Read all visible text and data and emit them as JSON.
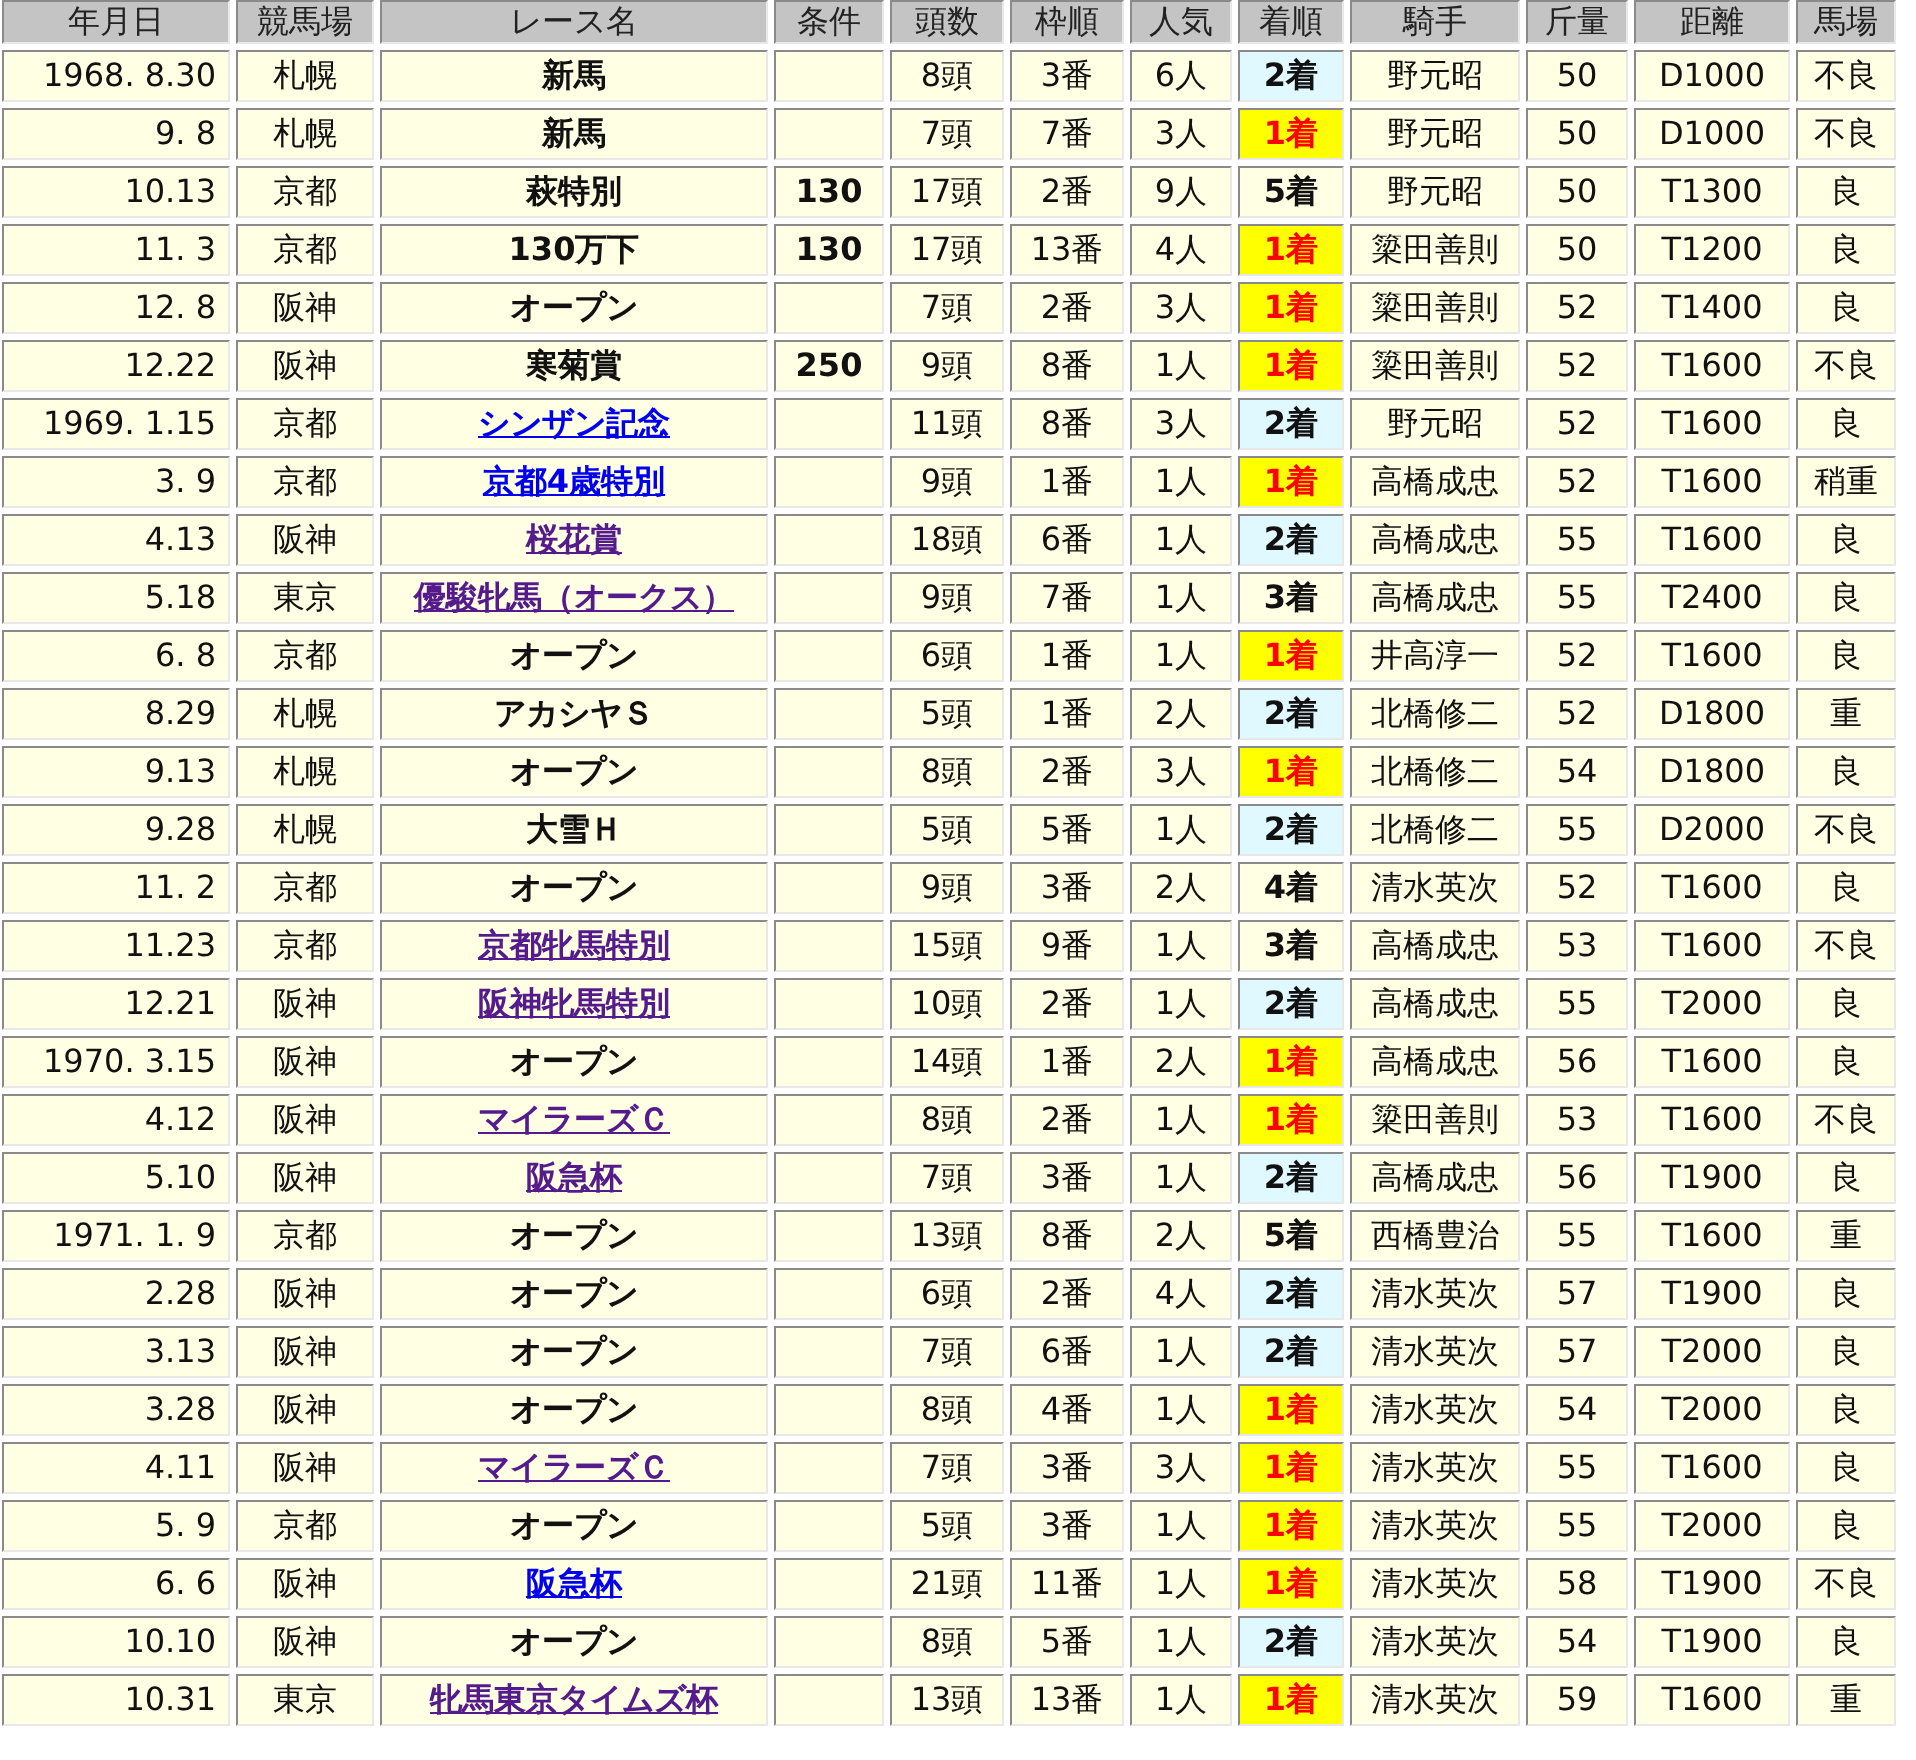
{
  "table": {
    "columns": [
      "年月日",
      "競馬場",
      "レース名",
      "条件",
      "頭数",
      "枠順",
      "人気",
      "着順",
      "騎手",
      "斤量",
      "距離",
      "馬場"
    ],
    "rows": [
      {
        "date": "1968. 8.30",
        "course": "札幌",
        "race": {
          "name": "新馬",
          "kind": "plain"
        },
        "condition": "",
        "runners": "8頭",
        "post": "3番",
        "popularity": "6人",
        "finish": {
          "text": "2着",
          "kind": "place"
        },
        "jockey": "野元昭",
        "weight": "50",
        "distance": "D1000",
        "going": "不良"
      },
      {
        "date": "9. 8",
        "course": "札幌",
        "race": {
          "name": "新馬",
          "kind": "plain"
        },
        "condition": "",
        "runners": "7頭",
        "post": "7番",
        "popularity": "3人",
        "finish": {
          "text": "1着",
          "kind": "win"
        },
        "jockey": "野元昭",
        "weight": "50",
        "distance": "D1000",
        "going": "不良"
      },
      {
        "date": "10.13",
        "course": "京都",
        "race": {
          "name": "萩特別",
          "kind": "plain"
        },
        "condition": "130",
        "runners": "17頭",
        "post": "2番",
        "popularity": "9人",
        "finish": {
          "text": "5着",
          "kind": "plain"
        },
        "jockey": "野元昭",
        "weight": "50",
        "distance": "T1300",
        "going": "良"
      },
      {
        "date": "11. 3",
        "course": "京都",
        "race": {
          "name": "130万下",
          "kind": "plain"
        },
        "condition": "130",
        "runners": "17頭",
        "post": "13番",
        "popularity": "4人",
        "finish": {
          "text": "1着",
          "kind": "win"
        },
        "jockey": "簗田善則",
        "weight": "50",
        "distance": "T1200",
        "going": "良"
      },
      {
        "date": "12. 8",
        "course": "阪神",
        "race": {
          "name": "オープン",
          "kind": "plain"
        },
        "condition": "",
        "runners": "7頭",
        "post": "2番",
        "popularity": "3人",
        "finish": {
          "text": "1着",
          "kind": "win"
        },
        "jockey": "簗田善則",
        "weight": "52",
        "distance": "T1400",
        "going": "良"
      },
      {
        "date": "12.22",
        "course": "阪神",
        "race": {
          "name": "寒菊賞",
          "kind": "plain"
        },
        "condition": "250",
        "runners": "9頭",
        "post": "8番",
        "popularity": "1人",
        "finish": {
          "text": "1着",
          "kind": "win"
        },
        "jockey": "簗田善則",
        "weight": "52",
        "distance": "T1600",
        "going": "不良"
      },
      {
        "date": "1969. 1.15",
        "course": "京都",
        "race": {
          "name": "シンザン記念",
          "kind": "link",
          "visited": false
        },
        "condition": "",
        "runners": "11頭",
        "post": "8番",
        "popularity": "3人",
        "finish": {
          "text": "2着",
          "kind": "place"
        },
        "jockey": "野元昭",
        "weight": "52",
        "distance": "T1600",
        "going": "良"
      },
      {
        "date": "3. 9",
        "course": "京都",
        "race": {
          "name": "京都4歳特別",
          "kind": "link",
          "visited": false
        },
        "condition": "",
        "runners": "9頭",
        "post": "1番",
        "popularity": "1人",
        "finish": {
          "text": "1着",
          "kind": "win"
        },
        "jockey": "高橋成忠",
        "weight": "52",
        "distance": "T1600",
        "going": "稍重"
      },
      {
        "date": "4.13",
        "course": "阪神",
        "race": {
          "name": "桜花賞",
          "kind": "link",
          "visited": true
        },
        "condition": "",
        "runners": "18頭",
        "post": "6番",
        "popularity": "1人",
        "finish": {
          "text": "2着",
          "kind": "place"
        },
        "jockey": "高橋成忠",
        "weight": "55",
        "distance": "T1600",
        "going": "良"
      },
      {
        "date": "5.18",
        "course": "東京",
        "race": {
          "name": "優駿牝馬（オークス）",
          "kind": "link",
          "visited": true
        },
        "condition": "",
        "runners": "9頭",
        "post": "7番",
        "popularity": "1人",
        "finish": {
          "text": "3着",
          "kind": "plain"
        },
        "jockey": "高橋成忠",
        "weight": "55",
        "distance": "T2400",
        "going": "良"
      },
      {
        "date": "6. 8",
        "course": "京都",
        "race": {
          "name": "オープン",
          "kind": "plain"
        },
        "condition": "",
        "runners": "6頭",
        "post": "1番",
        "popularity": "1人",
        "finish": {
          "text": "1着",
          "kind": "win"
        },
        "jockey": "井高淳一",
        "weight": "52",
        "distance": "T1600",
        "going": "良"
      },
      {
        "date": "8.29",
        "course": "札幌",
        "race": {
          "name": "アカシヤＳ",
          "kind": "plain"
        },
        "condition": "",
        "runners": "5頭",
        "post": "1番",
        "popularity": "2人",
        "finish": {
          "text": "2着",
          "kind": "place"
        },
        "jockey": "北橋修二",
        "weight": "52",
        "distance": "D1800",
        "going": "重"
      },
      {
        "date": "9.13",
        "course": "札幌",
        "race": {
          "name": "オープン",
          "kind": "plain"
        },
        "condition": "",
        "runners": "8頭",
        "post": "2番",
        "popularity": "3人",
        "finish": {
          "text": "1着",
          "kind": "win"
        },
        "jockey": "北橋修二",
        "weight": "54",
        "distance": "D1800",
        "going": "良"
      },
      {
        "date": "9.28",
        "course": "札幌",
        "race": {
          "name": "大雪Ｈ",
          "kind": "plain"
        },
        "condition": "",
        "runners": "5頭",
        "post": "5番",
        "popularity": "1人",
        "finish": {
          "text": "2着",
          "kind": "place"
        },
        "jockey": "北橋修二",
        "weight": "55",
        "distance": "D2000",
        "going": "不良"
      },
      {
        "date": "11. 2",
        "course": "京都",
        "race": {
          "name": "オープン",
          "kind": "plain"
        },
        "condition": "",
        "runners": "9頭",
        "post": "3番",
        "popularity": "2人",
        "finish": {
          "text": "4着",
          "kind": "plain"
        },
        "jockey": "清水英次",
        "weight": "52",
        "distance": "T1600",
        "going": "良"
      },
      {
        "date": "11.23",
        "course": "京都",
        "race": {
          "name": "京都牝馬特別",
          "kind": "link",
          "visited": true
        },
        "condition": "",
        "runners": "15頭",
        "post": "9番",
        "popularity": "1人",
        "finish": {
          "text": "3着",
          "kind": "plain"
        },
        "jockey": "高橋成忠",
        "weight": "53",
        "distance": "T1600",
        "going": "不良"
      },
      {
        "date": "12.21",
        "course": "阪神",
        "race": {
          "name": "阪神牝馬特別",
          "kind": "link",
          "visited": true
        },
        "condition": "",
        "runners": "10頭",
        "post": "2番",
        "popularity": "1人",
        "finish": {
          "text": "2着",
          "kind": "place"
        },
        "jockey": "高橋成忠",
        "weight": "55",
        "distance": "T2000",
        "going": "良"
      },
      {
        "date": "1970. 3.15",
        "course": "阪神",
        "race": {
          "name": "オープン",
          "kind": "plain"
        },
        "condition": "",
        "runners": "14頭",
        "post": "1番",
        "popularity": "2人",
        "finish": {
          "text": "1着",
          "kind": "win"
        },
        "jockey": "高橋成忠",
        "weight": "56",
        "distance": "T1600",
        "going": "良"
      },
      {
        "date": "4.12",
        "course": "阪神",
        "race": {
          "name": "マイラーズＣ",
          "kind": "link",
          "visited": true
        },
        "condition": "",
        "runners": "8頭",
        "post": "2番",
        "popularity": "1人",
        "finish": {
          "text": "1着",
          "kind": "win"
        },
        "jockey": "簗田善則",
        "weight": "53",
        "distance": "T1600",
        "going": "不良"
      },
      {
        "date": "5.10",
        "course": "阪神",
        "race": {
          "name": "阪急杯",
          "kind": "link",
          "visited": true
        },
        "condition": "",
        "runners": "7頭",
        "post": "3番",
        "popularity": "1人",
        "finish": {
          "text": "2着",
          "kind": "place"
        },
        "jockey": "高橋成忠",
        "weight": "56",
        "distance": "T1900",
        "going": "良"
      },
      {
        "date": "1971. 1. 9",
        "course": "京都",
        "race": {
          "name": "オープン",
          "kind": "plain"
        },
        "condition": "",
        "runners": "13頭",
        "post": "8番",
        "popularity": "2人",
        "finish": {
          "text": "5着",
          "kind": "plain"
        },
        "jockey": "西橋豊治",
        "weight": "55",
        "distance": "T1600",
        "going": "重"
      },
      {
        "date": "2.28",
        "course": "阪神",
        "race": {
          "name": "オープン",
          "kind": "plain"
        },
        "condition": "",
        "runners": "6頭",
        "post": "2番",
        "popularity": "4人",
        "finish": {
          "text": "2着",
          "kind": "place"
        },
        "jockey": "清水英次",
        "weight": "57",
        "distance": "T1900",
        "going": "良"
      },
      {
        "date": "3.13",
        "course": "阪神",
        "race": {
          "name": "オープン",
          "kind": "plain"
        },
        "condition": "",
        "runners": "7頭",
        "post": "6番",
        "popularity": "1人",
        "finish": {
          "text": "2着",
          "kind": "place"
        },
        "jockey": "清水英次",
        "weight": "57",
        "distance": "T2000",
        "going": "良"
      },
      {
        "date": "3.28",
        "course": "阪神",
        "race": {
          "name": "オープン",
          "kind": "plain"
        },
        "condition": "",
        "runners": "8頭",
        "post": "4番",
        "popularity": "1人",
        "finish": {
          "text": "1着",
          "kind": "win"
        },
        "jockey": "清水英次",
        "weight": "54",
        "distance": "T2000",
        "going": "良"
      },
      {
        "date": "4.11",
        "course": "阪神",
        "race": {
          "name": "マイラーズＣ",
          "kind": "link",
          "visited": true
        },
        "condition": "",
        "runners": "7頭",
        "post": "3番",
        "popularity": "3人",
        "finish": {
          "text": "1着",
          "kind": "win"
        },
        "jockey": "清水英次",
        "weight": "55",
        "distance": "T1600",
        "going": "良"
      },
      {
        "date": "5. 9",
        "course": "京都",
        "race": {
          "name": "オープン",
          "kind": "plain"
        },
        "condition": "",
        "runners": "5頭",
        "post": "3番",
        "popularity": "1人",
        "finish": {
          "text": "1着",
          "kind": "win"
        },
        "jockey": "清水英次",
        "weight": "55",
        "distance": "T2000",
        "going": "良"
      },
      {
        "date": "6. 6",
        "course": "阪神",
        "race": {
          "name": "阪急杯",
          "kind": "link",
          "visited": false
        },
        "condition": "",
        "runners": "21頭",
        "post": "11番",
        "popularity": "1人",
        "finish": {
          "text": "1着",
          "kind": "win"
        },
        "jockey": "清水英次",
        "weight": "58",
        "distance": "T1900",
        "going": "不良"
      },
      {
        "date": "10.10",
        "course": "阪神",
        "race": {
          "name": "オープン",
          "kind": "plain"
        },
        "condition": "",
        "runners": "8頭",
        "post": "5番",
        "popularity": "1人",
        "finish": {
          "text": "2着",
          "kind": "place"
        },
        "jockey": "清水英次",
        "weight": "54",
        "distance": "T1900",
        "going": "良"
      },
      {
        "date": "10.31",
        "course": "東京",
        "race": {
          "name": "牝馬東京タイムズ杯",
          "kind": "link",
          "visited": true
        },
        "condition": "",
        "runners": "13頭",
        "post": "13番",
        "popularity": "1人",
        "finish": {
          "text": "1着",
          "kind": "win"
        },
        "jockey": "清水英次",
        "weight": "59",
        "distance": "T1600",
        "going": "重"
      }
    ]
  }
}
